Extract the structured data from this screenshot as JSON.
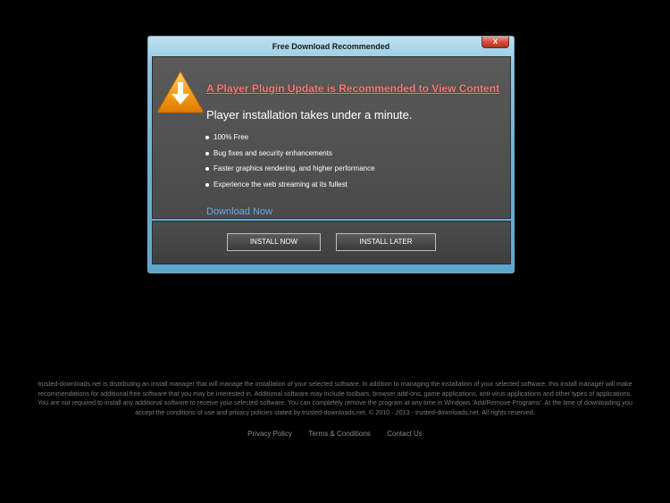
{
  "dialog": {
    "title": "Free Download Recommended",
    "close_label": "x",
    "headline": "A Player Plugin Update is Recommended to View Content",
    "subhead": "Player installation takes under a minute.",
    "features": [
      "100% Free",
      "Bug fixes and security enhancements",
      "Faster graphics rendering, and higher performance",
      "Experience the web streaming at its fullest"
    ],
    "download_link": "Download Now",
    "install_now_label": "INSTALL NOW",
    "install_later_label": "INSTALL LATER"
  },
  "footer": {
    "legal_lines": [
      "trusted-downloads.net is distributing an install manager that will manage the installation of your selected software. In addition to managing the installation of your selected software, this install manager will make",
      "recommendations for additional free software that you may be interested in. Additional software may include toolbars, browser add-ons, game applications, anti-virus applications and other types of applications.",
      "You are not required to install any additional software to receive your selected software. You can completely remove the program at any time in Windows 'Add/Remove Programs'. At the time of downloading you",
      "accept the conditions of use and privacy policies stated by trusted-downloads.net. © 2010 - 2013 - trusted-downloads.net. All rights reserved."
    ],
    "links": [
      "Privacy Policy",
      "Terms & Conditions",
      "Contact Us"
    ]
  },
  "icons": {
    "warning": "warning-icon",
    "close": "close-icon"
  },
  "colors": {
    "page_background": "#000000",
    "headline": "#f07f7f",
    "download_link": "#6fa8dc",
    "dialog_frame": "#6fb2d3",
    "panel": "#4a4a4a"
  }
}
